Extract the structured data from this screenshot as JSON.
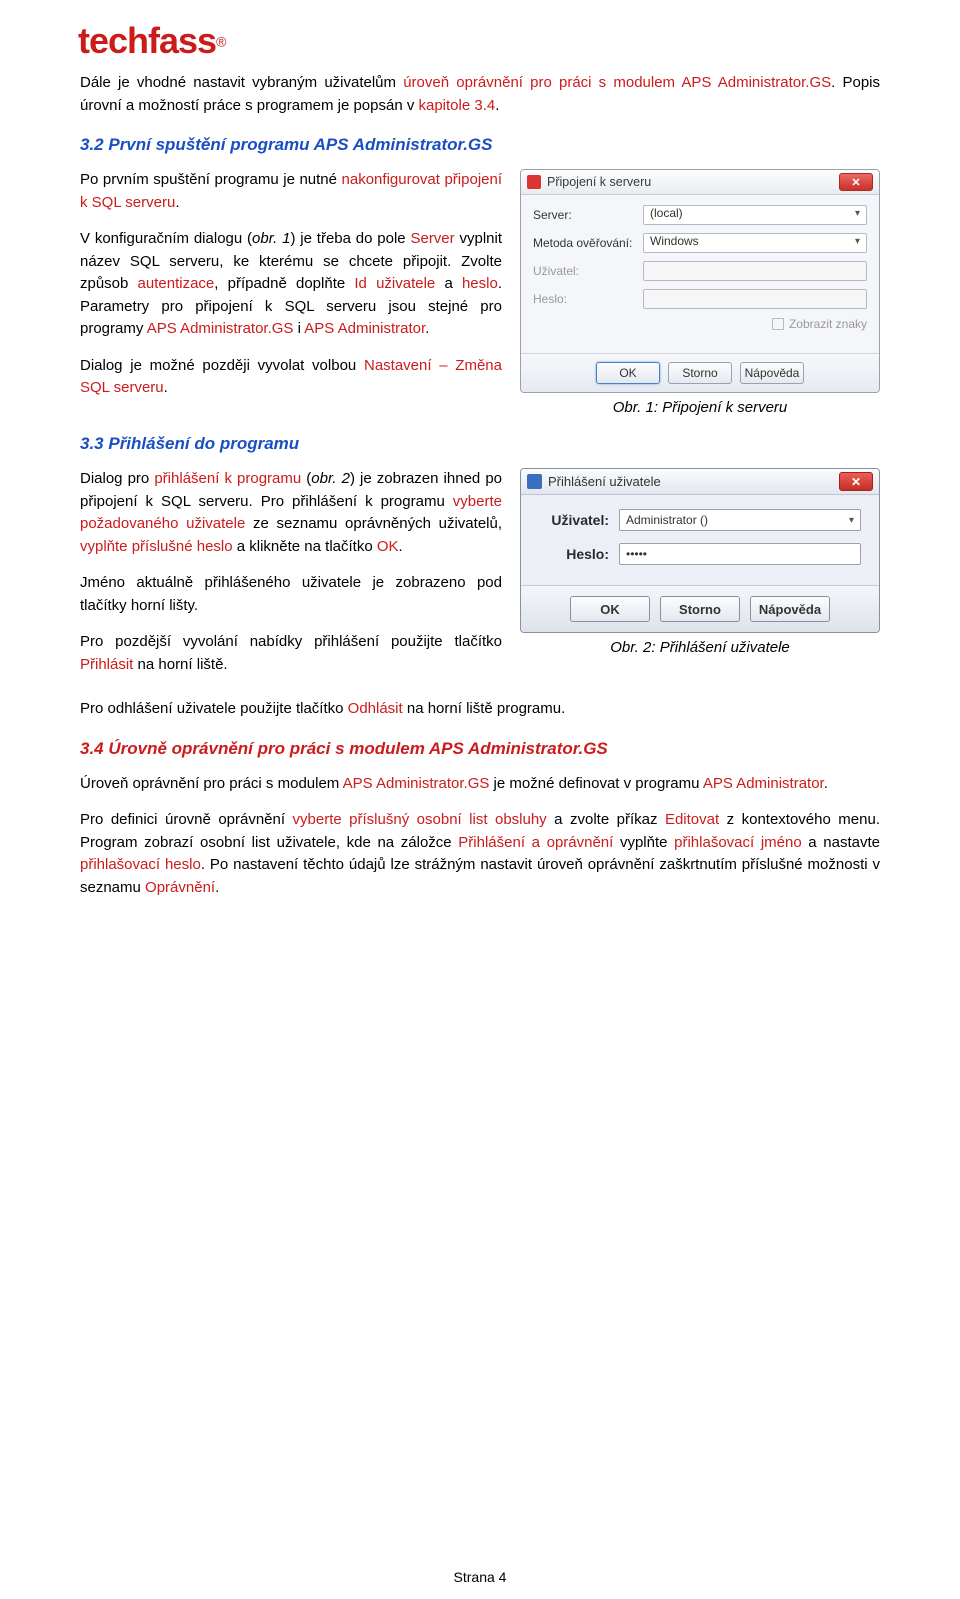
{
  "logo": {
    "text": "techfass",
    "reg": "®"
  },
  "intro": {
    "t1": "Dále je vhodné nastavit vybraným uživatelům ",
    "t2": "úroveň oprávnění pro práci s modulem APS Administrator.GS",
    "t3": ". Popis úrovní a možností práce s programem je popsán v ",
    "t4": "kapitole 3.4",
    "t5": "."
  },
  "s32": {
    "heading": "3.2 První spuštění programu APS Administrator.GS",
    "p1a": "Po prvním spuštění programu je nutné ",
    "p1b": "nakonfigurovat připojení k SQL serveru",
    "p1c": ".",
    "p2a": "V konfiguračním dialogu (",
    "p2b": "obr. 1",
    "p2c": ") je třeba do pole ",
    "p2d": "Server",
    "p2e": " vyplnit název SQL serveru, ke kterému se chcete připojit. Zvolte způsob ",
    "p2f": "autentizace",
    "p2g": ", případně doplňte ",
    "p2h": "Id uživatele",
    "p2i": " a ",
    "p2j": "heslo",
    "p2k": ". Parametry pro připojení k SQL serveru jsou stejné pro programy ",
    "p2l": "APS Administrator.GS",
    "p2m": " i ",
    "p2n": "APS Administrator",
    "p2o": ".",
    "p3a": "Dialog je možné později vyvolat volbou ",
    "p3b": "Nastavení – Změna SQL serveru",
    "p3c": ".",
    "caption": "Obr. 1: Připojení k serveru"
  },
  "dlg1": {
    "title": "Připojení k serveru",
    "server_label": "Server:",
    "server_value": "(local)",
    "auth_label": "Metoda ověřování:",
    "auth_value": "Windows",
    "user_label": "Uživatel:",
    "pass_label": "Heslo:",
    "showchars": "Zobrazit znaky",
    "ok": "OK",
    "cancel": "Storno",
    "help": "Nápověda"
  },
  "s33": {
    "heading": "3.3 Přihlášení do programu",
    "p1a": "Dialog pro ",
    "p1b": "přihlášení k programu",
    "p1c": " (",
    "p1d": "obr. 2",
    "p1e": ") je zobrazen ihned po připojení k SQL serveru. Pro přihlášení k programu ",
    "p1f": "vyberte požadovaného uživatele",
    "p1g": " ze seznamu oprávněných uživatelů, ",
    "p1h": "vyplňte příslušné heslo",
    "p1i": " a klikněte na tlačítko ",
    "p1j": "OK",
    "p1k": ".",
    "p2": "Jméno aktuálně přihlášeného uživatele je zobrazeno pod tlačítky horní lišty.",
    "p3a": "Pro pozdější vyvolání nabídky přihlášení použijte tlačítko ",
    "p3b": "Přihlásit",
    "p3c": " na horní liště.",
    "p4a": "Pro odhlášení uživatele použijte tlačítko ",
    "p4b": "Odhlásit",
    "p4c": " na horní liště programu.",
    "caption": "Obr. 2: Přihlášení uživatele"
  },
  "dlg2": {
    "title": "Přihlášení uživatele",
    "user_label": "Uživatel:",
    "user_value": "Administrator ()",
    "pass_label": "Heslo:",
    "pass_value": "•••••",
    "ok": "OK",
    "cancel": "Storno",
    "help": "Nápověda"
  },
  "s34": {
    "heading": "3.4 Úrovně oprávnění pro práci s modulem APS Administrator.GS",
    "p1a": "Úroveň oprávnění pro práci s modulem ",
    "p1b": "APS Administrator.GS",
    "p1c": " je možné definovat v programu ",
    "p1d": "APS Administrator",
    "p1e": ".",
    "p2a": "Pro definici úrovně oprávnění ",
    "p2b": "vyberte příslušný osobní list obsluhy",
    "p2c": " a zvolte příkaz ",
    "p2d": "Editovat",
    "p2e": " z kontextového menu. Program zobrazí osobní list uživatele, kde na záložce ",
    "p2f": "Přihlášení a oprávnění",
    "p2g": " vyplňte ",
    "p2h": "přihlašovací jméno",
    "p2i": " a nastavte ",
    "p2j": "přihlašovací heslo",
    "p2k": ". Po nastavení těchto údajů lze strážným nastavit úroveň oprávnění zaškrtnutím příslušné možnosti v seznamu ",
    "p2l": "Oprávnění",
    "p2m": "."
  },
  "footer": {
    "text": "Strana 4"
  }
}
